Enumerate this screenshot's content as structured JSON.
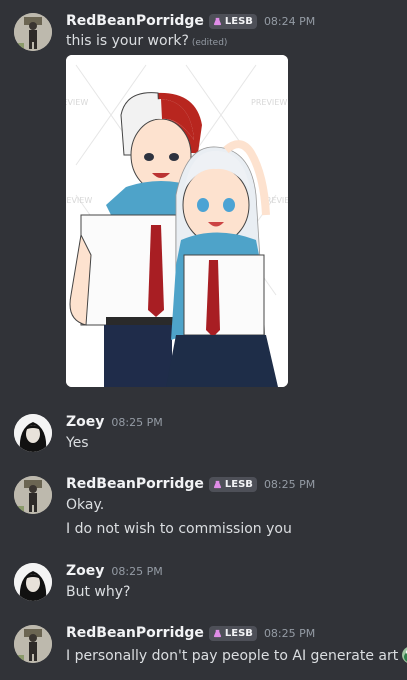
{
  "messages": [
    {
      "user": "RedBeanPorridge",
      "tag": "LESB",
      "time": "08:24 PM",
      "lines": [
        "this is your work?"
      ],
      "edited": "(edited)",
      "watermark": "PREVIEW"
    },
    {
      "user": "Zoey",
      "time": "08:25 PM",
      "lines": [
        "Yes"
      ]
    },
    {
      "user": "RedBeanPorridge",
      "tag": "LESB",
      "time": "08:25 PM",
      "lines": [
        "Okay.",
        "I do not wish to commission you"
      ]
    },
    {
      "user": "Zoey",
      "time": "08:25 PM",
      "lines": [
        "But why?"
      ]
    },
    {
      "user": "RedBeanPorridge",
      "tag": "LESB",
      "time": "08:25 PM",
      "lines": [
        "I personally don't pay people to AI generate art"
      ]
    }
  ],
  "colors": {
    "background": "#313338",
    "username": "#f2f3f5",
    "timestamp": "#949ba4",
    "text": "#dbdee1",
    "tag_bg": "#4e5058",
    "tag_icon": "#e08de8"
  }
}
